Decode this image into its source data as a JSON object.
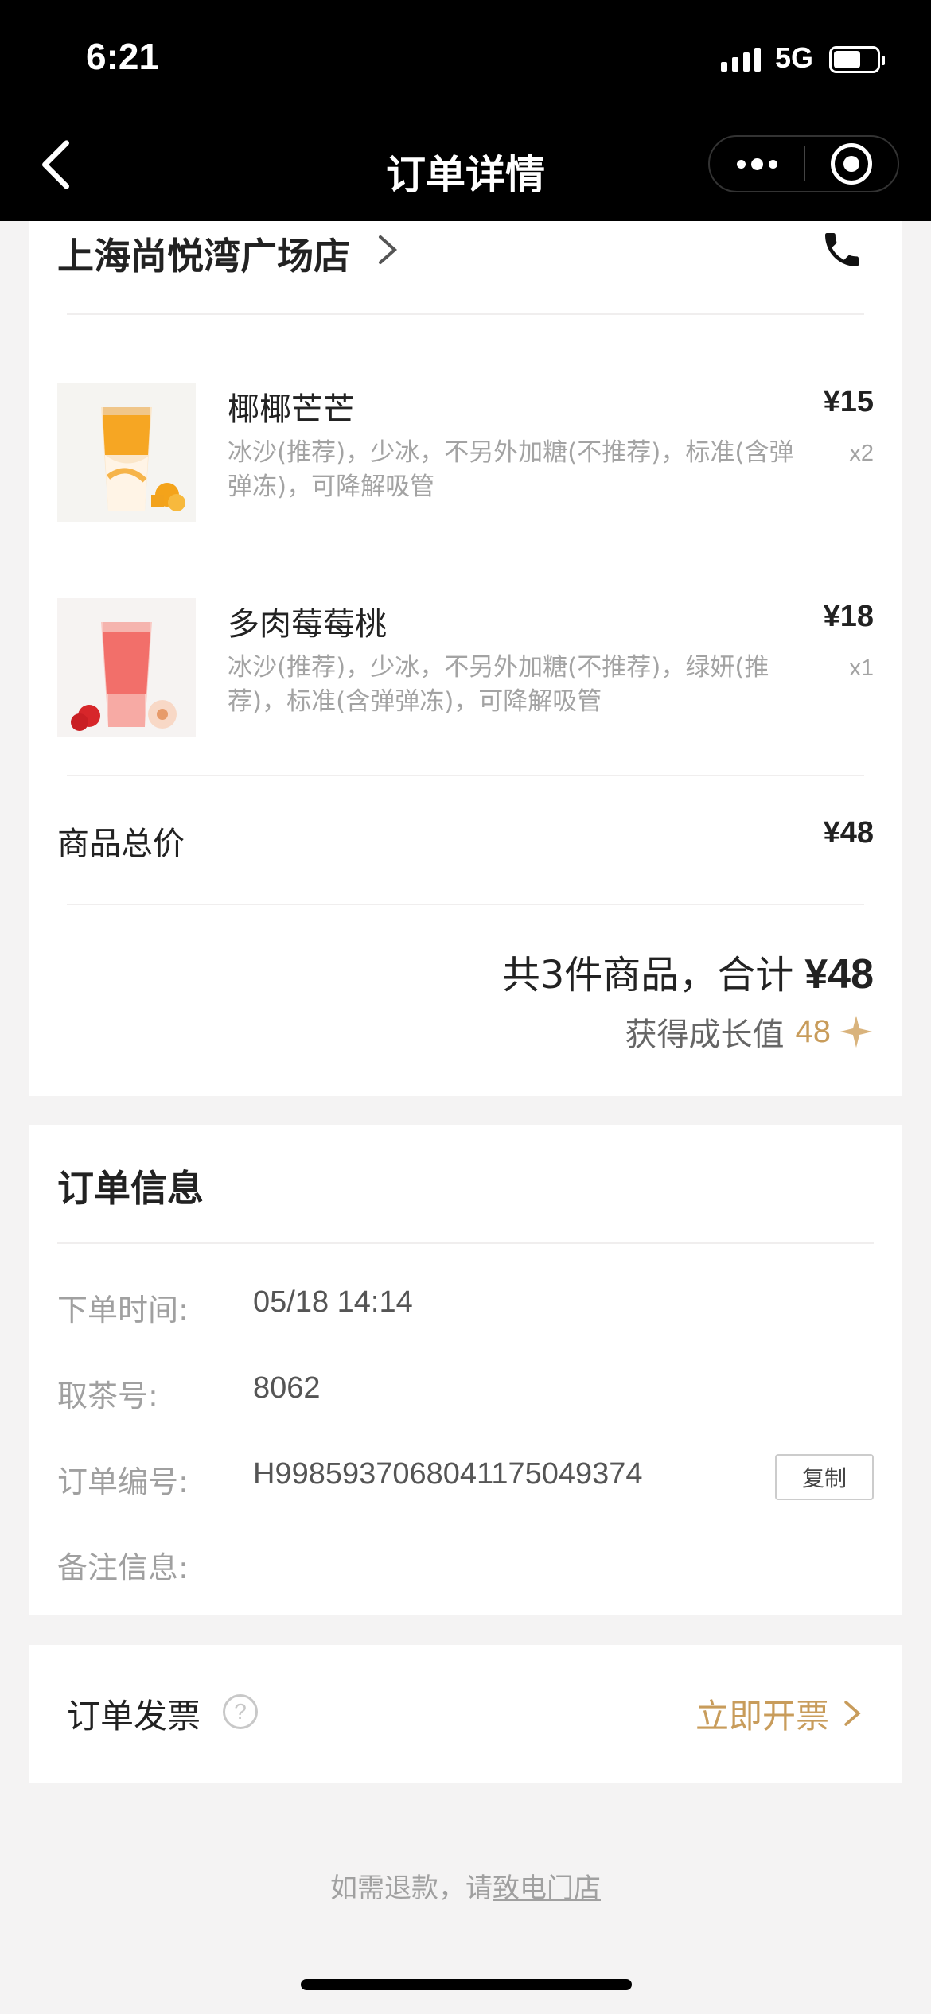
{
  "status_bar": {
    "time": "6:21",
    "network": "5G",
    "battery_level": 0.64
  },
  "nav": {
    "title": "订单详情"
  },
  "store": {
    "name": "上海尚悦湾广场店"
  },
  "items": [
    {
      "name": "椰椰芒芒",
      "spec": "冰沙(推荐)，少冰，不另外加糖(不推荐)，标准(含弹弹冻)，可降解吸管",
      "price": "¥15",
      "qty": "x2"
    },
    {
      "name": "多肉莓莓桃",
      "spec": "冰沙(推荐)，少冰，不另外加糖(不推荐)，绿妍(推荐)，标准(含弹弹冻)，可降解吸管",
      "price": "¥18",
      "qty": "x1"
    }
  ],
  "subtotal": {
    "label": "商品总价",
    "value": "¥48"
  },
  "summary": {
    "text": "共3件商品，合计",
    "amount": "¥48"
  },
  "growth": {
    "label": "获得成长值",
    "value": "48"
  },
  "order_info": {
    "title": "订单信息",
    "rows": [
      {
        "label": "下单时间:",
        "value": "05/18 14:14"
      },
      {
        "label": "取茶号:",
        "value": "8062"
      },
      {
        "label": "订单编号:",
        "value": "H9985937068041175049374"
      },
      {
        "label": "备注信息:",
        "value": ""
      }
    ],
    "copy_label": "复制"
  },
  "invoice": {
    "label": "订单发票",
    "help": "?",
    "action": "立即开票"
  },
  "refund": {
    "prefix": "如需退款，请",
    "link": "致电门店"
  },
  "colors": {
    "accent": "#c89c5b",
    "background": "#f4f3f3",
    "header": "#000000"
  }
}
